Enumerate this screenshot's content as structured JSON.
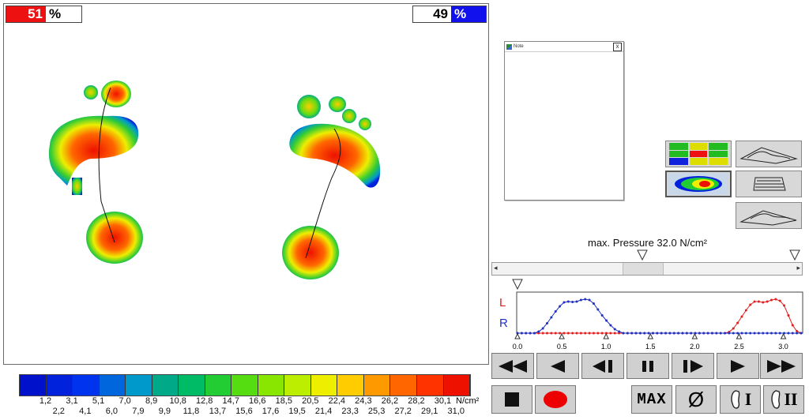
{
  "balance": {
    "left_value": "51",
    "right_value": "49",
    "percent_symbol": "%"
  },
  "note": {
    "title": "Note",
    "close_symbol": "x"
  },
  "max_pressure": "max. Pressure 32.0 N/cm²",
  "legend": {
    "unit": "N/cm²",
    "top_labels": [
      "1,2",
      "3,1",
      "5,1",
      "7,0",
      "8,9",
      "10,8",
      "12,8",
      "14,7",
      "16,6",
      "18,5",
      "20,5",
      "22,4",
      "24,3",
      "26,2",
      "28,2",
      "30,1"
    ],
    "bottom_labels": [
      "2,2",
      "4,1",
      "6,0",
      "7,9",
      "9,9",
      "11,8",
      "13,7",
      "15,6",
      "17,6",
      "19,5",
      "21,4",
      "23,3",
      "25,3",
      "27,2",
      "29,1",
      "31,0"
    ],
    "colors": [
      "#0011cc",
      "#0022dd",
      "#0033ee",
      "#0066dd",
      "#0099cc",
      "#00aa88",
      "#00bb66",
      "#22cc33",
      "#55dd11",
      "#88e600",
      "#bbee00",
      "#eeee00",
      "#ffcc00",
      "#ff9900",
      "#ff6600",
      "#ff3300",
      "#ee1100"
    ]
  },
  "graph": {
    "label_left": "L",
    "label_right": "R",
    "x_ticks": [
      "0.0",
      "0.5",
      "1.0",
      "1.5",
      "2.0",
      "2.5",
      "3.0"
    ],
    "series": [
      {
        "name": "L",
        "color": "#e02020",
        "values": [
          0,
          0,
          0,
          0,
          0,
          0,
          0,
          0,
          0,
          0,
          0,
          0,
          0,
          0,
          0,
          0,
          0,
          0,
          0,
          0,
          0,
          0,
          0,
          0,
          0,
          0,
          0,
          0,
          0,
          0,
          0,
          0,
          0,
          0,
          0,
          0,
          0,
          0,
          0,
          0,
          0,
          0,
          0,
          0,
          0,
          0,
          0,
          0,
          0,
          0,
          0.03,
          0.12,
          0.26,
          0.42,
          0.58,
          0.72,
          0.8,
          0.8,
          0.78,
          0.8,
          0.84,
          0.86,
          0.82,
          0.7,
          0.45,
          0.2,
          0.05,
          0
        ]
      },
      {
        "name": "R",
        "color": "#2030c0",
        "values": [
          0,
          0,
          0,
          0,
          0,
          0.04,
          0.12,
          0.25,
          0.4,
          0.55,
          0.68,
          0.78,
          0.8,
          0.79,
          0.8,
          0.84,
          0.86,
          0.84,
          0.75,
          0.6,
          0.45,
          0.32,
          0.2,
          0.1,
          0.04,
          0,
          0,
          0,
          0,
          0,
          0,
          0,
          0,
          0,
          0,
          0,
          0,
          0,
          0,
          0,
          0,
          0,
          0,
          0,
          0,
          0,
          0,
          0,
          0,
          0,
          0,
          0,
          0,
          0,
          0,
          0,
          0,
          0,
          0,
          0,
          0,
          0,
          0,
          0,
          0,
          0,
          0,
          0
        ]
      }
    ]
  },
  "bottom_buttons": {
    "max_label": "MAX",
    "diameter_symbol": "Ø",
    "foot1_label": "I",
    "foot2_label": "II"
  }
}
